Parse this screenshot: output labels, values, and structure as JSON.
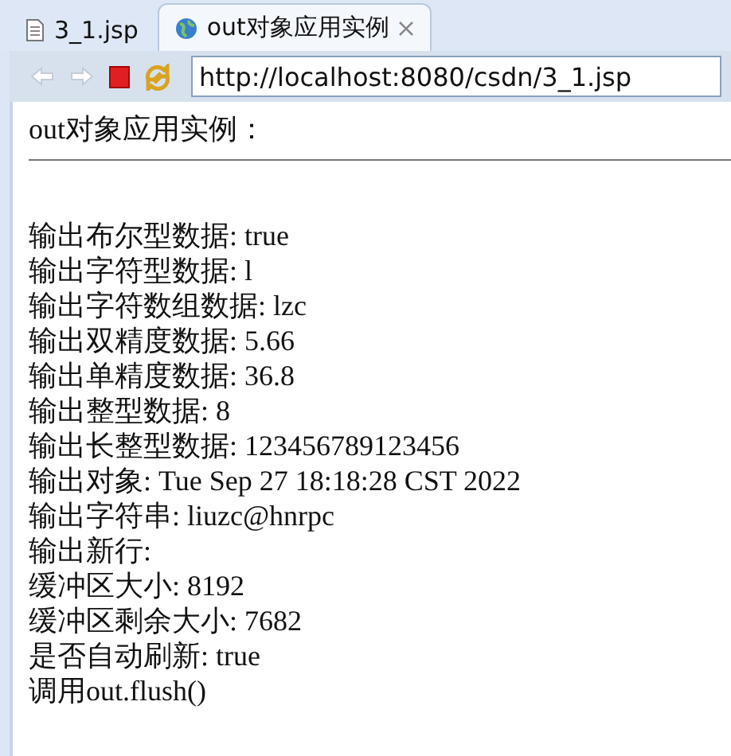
{
  "tabs": [
    {
      "label": "3_1.jsp",
      "kind": "file",
      "selected": false
    },
    {
      "label": "out对象应用实例",
      "kind": "web",
      "selected": true
    }
  ],
  "toolbar": {
    "buttons": [
      {
        "kind": "back",
        "disabled": true
      },
      {
        "kind": "forward",
        "disabled": true
      },
      {
        "kind": "stop",
        "disabled": false
      },
      {
        "kind": "refresh",
        "disabled": false
      }
    ],
    "address": "http://localhost:8080/csdn/3_1.jsp"
  },
  "page": {
    "heading": "out对象应用实例：",
    "lines": [
      "输出布尔型数据: true",
      "输出字符型数据: l",
      "输出字符数组数据: lzc",
      "输出双精度数据: 5.66",
      "输出单精度数据: 36.8",
      "输出整型数据: 8",
      "输出长整型数据: 123456789123456",
      "输出对象: Tue Sep 27 18:18:28 CST 2022",
      "输出字符串: liuzc@hnrpc",
      "输出新行:",
      "缓冲区大小: 8192",
      "缓冲区剩余大小: 7682",
      "是否自动刷新: true",
      "调用out.flush()"
    ]
  }
}
